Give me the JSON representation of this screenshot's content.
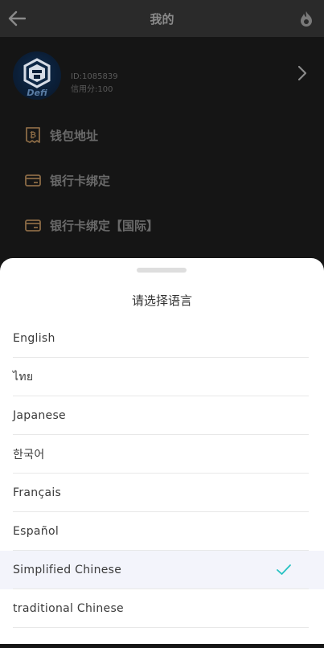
{
  "header": {
    "title": "我的",
    "back_icon": "arrow-left-icon",
    "right_icon": "flame-icon"
  },
  "profile": {
    "avatar_text": "Defi",
    "id_text": "ID:1085839",
    "credit_text": "信用分:100"
  },
  "menu": [
    {
      "label": "钱包地址",
      "icon": "bitcoin-receipt-icon"
    },
    {
      "label": "银行卡绑定",
      "icon": "card-icon"
    },
    {
      "label": "银行卡绑定【国际】",
      "icon": "card-icon"
    }
  ],
  "sheet": {
    "title": "请选择语言",
    "options": [
      {
        "label": "English"
      },
      {
        "label": "ไทย"
      },
      {
        "label": "Japanese"
      },
      {
        "label": "한국어"
      },
      {
        "label": "Français"
      },
      {
        "label": "Español"
      },
      {
        "label": "Simplified Chinese"
      },
      {
        "label": "traditional Chinese"
      }
    ],
    "selected_index": 6
  },
  "colors": {
    "accent": "#26c2c2",
    "menu_icon": "#8a6a45"
  }
}
